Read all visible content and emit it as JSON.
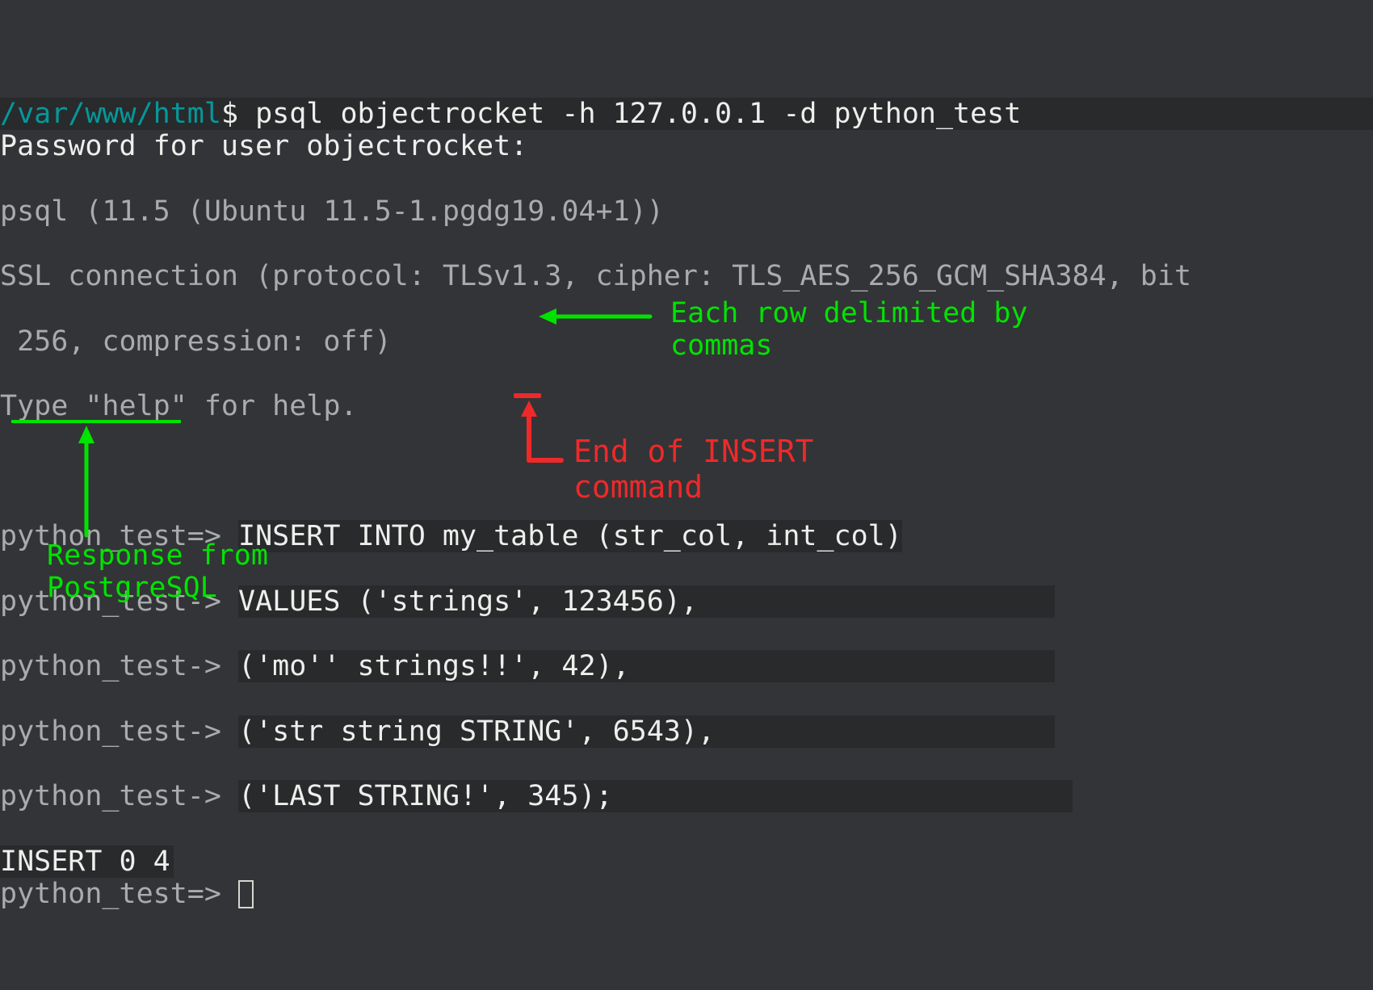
{
  "prompt_path": "/var/www/html",
  "prompt_symbol": "$",
  "cmd": " psql objectrocket -h 127.0.0.1 -d python_test",
  "line_password": "Password for user objectrocket:",
  "line_psql_ver": "psql (11.5 (Ubuntu 11.5-1.pgdg19.04+1))",
  "line_ssl_a": "SSL connection (protocol: TLSv1.3, cipher: TLS_AES_256_GCM_SHA384, bit",
  "line_ssl_b": " 256, compression: off)",
  "line_help": "Type \"help\" for help.",
  "psql_prompt_main": "python_test=> ",
  "psql_prompt_cont": "python_test-> ",
  "sql_line1": "INSERT INTO my_table (str_col, int_col)",
  "sql_line2": "VALUES ('strings', 123456),",
  "sql_line3": "('mo'' strings!!', 42),",
  "sql_line4": "('str string STRING', 6543),",
  "sql_line5": "('LAST STRING!', 345);",
  "insert_result": "INSERT 0 4",
  "ann_rows_a": "Each row delimited by",
  "ann_rows_b": "commas",
  "ann_resp_a": "Response from",
  "ann_resp_b": "PostgreSQL",
  "ann_end_a": "End of INSERT",
  "ann_end_b": "command"
}
